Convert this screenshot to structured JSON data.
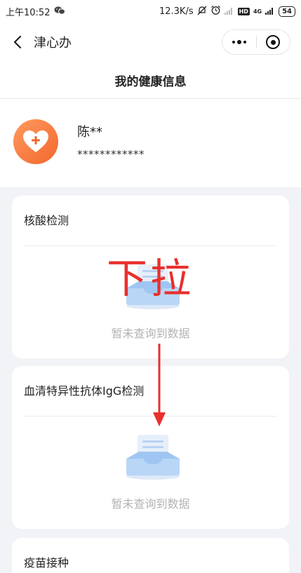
{
  "status_bar": {
    "time": "上午10:52",
    "speed": "12.3K/s",
    "network": "4G",
    "hd": "HD",
    "battery": "54"
  },
  "nav": {
    "title": "津心办"
  },
  "page": {
    "title": "我的健康信息"
  },
  "profile": {
    "name": "陈**",
    "id_masked": "************"
  },
  "cards": [
    {
      "title": "核酸检测",
      "empty_text": "暂未查询到数据"
    },
    {
      "title": "血清特异性抗体IgG检测",
      "empty_text": "暂未查询到数据"
    },
    {
      "title": "疫苗接种"
    }
  ],
  "annotation": {
    "text": "下拉",
    "color": "#e8302d"
  },
  "colors": {
    "avatar_start": "#ff9a5e",
    "avatar_end": "#f2672e",
    "illustration_blue": "#9fc6f2"
  }
}
